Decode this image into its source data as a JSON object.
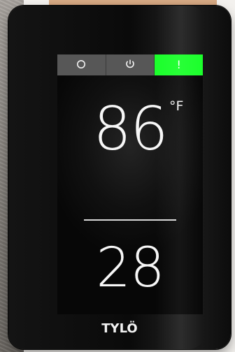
{
  "brand": {
    "logo_text": "TYLÖ"
  },
  "mode_bar": {
    "items": [
      {
        "icon": "circle-icon",
        "label": "O"
      },
      {
        "icon": "power-icon",
        "label": ""
      },
      {
        "icon": "on-icon",
        "label": "!"
      }
    ],
    "active_index": 2,
    "active_color": "#1bff2b"
  },
  "temperature": {
    "value": "86",
    "unit": "°F"
  },
  "secondary": {
    "value": "28"
  },
  "bottom_icons": [
    {
      "icon": "home-icon"
    },
    {
      "icon": "thermometer-icon"
    },
    {
      "icon": "heart-icon"
    },
    {
      "icon": "calendar-icon"
    },
    {
      "icon": "settings-icon"
    }
  ]
}
